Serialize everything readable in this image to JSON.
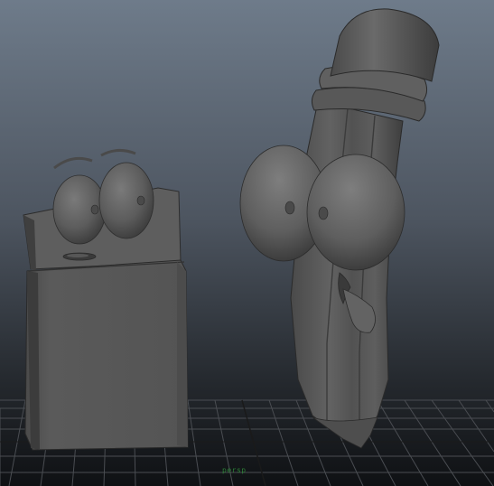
{
  "viewport": {
    "gradient_top": "#6e7b8a",
    "gradient_bottom": "#0f1114",
    "grid_color": "#4a4d52",
    "grid_axis_color": "#1a1a1a",
    "origin_label": "persp"
  },
  "objects": [
    {
      "name": "notepad-character",
      "color": "#5a5a5a"
    },
    {
      "name": "pencil-character",
      "color": "#5c5c5c"
    }
  ]
}
